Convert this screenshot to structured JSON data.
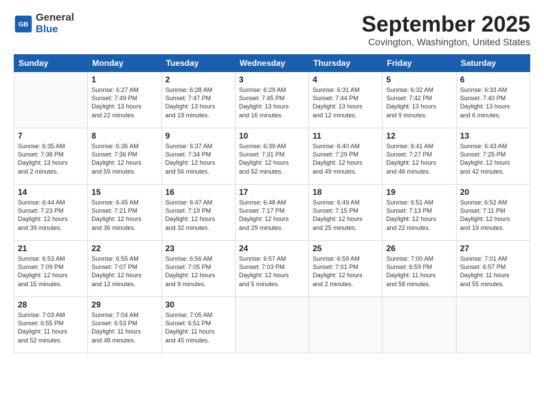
{
  "header": {
    "logo_general": "General",
    "logo_blue": "Blue",
    "month_title": "September 2025",
    "location": "Covington, Washington, United States"
  },
  "weekdays": [
    "Sunday",
    "Monday",
    "Tuesday",
    "Wednesday",
    "Thursday",
    "Friday",
    "Saturday"
  ],
  "weeks": [
    [
      {
        "day": "",
        "info": ""
      },
      {
        "day": "1",
        "info": "Sunrise: 6:27 AM\nSunset: 7:49 PM\nDaylight: 13 hours\nand 22 minutes."
      },
      {
        "day": "2",
        "info": "Sunrise: 6:28 AM\nSunset: 7:47 PM\nDaylight: 13 hours\nand 19 minutes."
      },
      {
        "day": "3",
        "info": "Sunrise: 6:29 AM\nSunset: 7:45 PM\nDaylight: 13 hours\nand 16 minutes."
      },
      {
        "day": "4",
        "info": "Sunrise: 6:31 AM\nSunset: 7:44 PM\nDaylight: 13 hours\nand 12 minutes."
      },
      {
        "day": "5",
        "info": "Sunrise: 6:32 AM\nSunset: 7:42 PM\nDaylight: 13 hours\nand 9 minutes."
      },
      {
        "day": "6",
        "info": "Sunrise: 6:33 AM\nSunset: 7:40 PM\nDaylight: 13 hours\nand 6 minutes."
      }
    ],
    [
      {
        "day": "7",
        "info": "Sunrise: 6:35 AM\nSunset: 7:38 PM\nDaylight: 13 hours\nand 2 minutes."
      },
      {
        "day": "8",
        "info": "Sunrise: 6:36 AM\nSunset: 7:36 PM\nDaylight: 12 hours\nand 59 minutes."
      },
      {
        "day": "9",
        "info": "Sunrise: 6:37 AM\nSunset: 7:34 PM\nDaylight: 12 hours\nand 56 minutes."
      },
      {
        "day": "10",
        "info": "Sunrise: 6:39 AM\nSunset: 7:31 PM\nDaylight: 12 hours\nand 52 minutes."
      },
      {
        "day": "11",
        "info": "Sunrise: 6:40 AM\nSunset: 7:29 PM\nDaylight: 12 hours\nand 49 minutes."
      },
      {
        "day": "12",
        "info": "Sunrise: 6:41 AM\nSunset: 7:27 PM\nDaylight: 12 hours\nand 46 minutes."
      },
      {
        "day": "13",
        "info": "Sunrise: 6:43 AM\nSunset: 7:25 PM\nDaylight: 12 hours\nand 42 minutes."
      }
    ],
    [
      {
        "day": "14",
        "info": "Sunrise: 6:44 AM\nSunset: 7:23 PM\nDaylight: 12 hours\nand 39 minutes."
      },
      {
        "day": "15",
        "info": "Sunrise: 6:45 AM\nSunset: 7:21 PM\nDaylight: 12 hours\nand 36 minutes."
      },
      {
        "day": "16",
        "info": "Sunrise: 6:47 AM\nSunset: 7:19 PM\nDaylight: 12 hours\nand 32 minutes."
      },
      {
        "day": "17",
        "info": "Sunrise: 6:48 AM\nSunset: 7:17 PM\nDaylight: 12 hours\nand 29 minutes."
      },
      {
        "day": "18",
        "info": "Sunrise: 6:49 AM\nSunset: 7:15 PM\nDaylight: 12 hours\nand 25 minutes."
      },
      {
        "day": "19",
        "info": "Sunrise: 6:51 AM\nSunset: 7:13 PM\nDaylight: 12 hours\nand 22 minutes."
      },
      {
        "day": "20",
        "info": "Sunrise: 6:52 AM\nSunset: 7:11 PM\nDaylight: 12 hours\nand 19 minutes."
      }
    ],
    [
      {
        "day": "21",
        "info": "Sunrise: 6:53 AM\nSunset: 7:09 PM\nDaylight: 12 hours\nand 15 minutes."
      },
      {
        "day": "22",
        "info": "Sunrise: 6:55 AM\nSunset: 7:07 PM\nDaylight: 12 hours\nand 12 minutes."
      },
      {
        "day": "23",
        "info": "Sunrise: 6:56 AM\nSunset: 7:05 PM\nDaylight: 12 hours\nand 9 minutes."
      },
      {
        "day": "24",
        "info": "Sunrise: 6:57 AM\nSunset: 7:03 PM\nDaylight: 12 hours\nand 5 minutes."
      },
      {
        "day": "25",
        "info": "Sunrise: 6:59 AM\nSunset: 7:01 PM\nDaylight: 12 hours\nand 2 minutes."
      },
      {
        "day": "26",
        "info": "Sunrise: 7:00 AM\nSunset: 6:59 PM\nDaylight: 11 hours\nand 58 minutes."
      },
      {
        "day": "27",
        "info": "Sunrise: 7:01 AM\nSunset: 6:57 PM\nDaylight: 11 hours\nand 55 minutes."
      }
    ],
    [
      {
        "day": "28",
        "info": "Sunrise: 7:03 AM\nSunset: 6:55 PM\nDaylight: 11 hours\nand 52 minutes."
      },
      {
        "day": "29",
        "info": "Sunrise: 7:04 AM\nSunset: 6:53 PM\nDaylight: 11 hours\nand 48 minutes."
      },
      {
        "day": "30",
        "info": "Sunrise: 7:05 AM\nSunset: 6:51 PM\nDaylight: 11 hours\nand 45 minutes."
      },
      {
        "day": "",
        "info": ""
      },
      {
        "day": "",
        "info": ""
      },
      {
        "day": "",
        "info": ""
      },
      {
        "day": "",
        "info": ""
      }
    ]
  ]
}
